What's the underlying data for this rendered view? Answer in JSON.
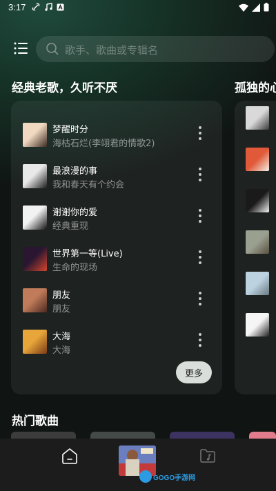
{
  "status_bar": {
    "time": "3:17",
    "icons_left": [
      "link-icon",
      "music-note-icon",
      "font-icon"
    ],
    "icons_right": [
      "wifi-icon",
      "signal-icon",
      "battery-icon"
    ]
  },
  "search": {
    "placeholder": "歌手、歌曲或专辑名"
  },
  "sections": {
    "classic_title": "经典老歌，久听不厌",
    "lonely_title": "孤独的心",
    "hot_title": "热门歌曲"
  },
  "classic_songs": [
    {
      "title": "梦醒时分",
      "subtitle": "海枯石烂(李翊君的情歌2)",
      "thumb_colors": [
        "#f0d9c0",
        "#3b2a22"
      ]
    },
    {
      "title": "最浪漫的事",
      "subtitle": "我和春天有个约会",
      "thumb_colors": [
        "#e8e8e8",
        "#1a1a1a"
      ]
    },
    {
      "title": "谢谢你的爱",
      "subtitle": "经典重现",
      "thumb_colors": [
        "#f2f2f2",
        "#111111"
      ]
    },
    {
      "title": "世界第一等(Live)",
      "subtitle": "生命的现场",
      "thumb_colors": [
        "#2a1630",
        "#d4452e"
      ]
    },
    {
      "title": "朋友",
      "subtitle": "朋友",
      "thumb_colors": [
        "#c07b5a",
        "#4a2a20"
      ]
    },
    {
      "title": "大海",
      "subtitle": "大海",
      "thumb_colors": [
        "#e8a63a",
        "#7a3a16"
      ]
    }
  ],
  "more_label": "更多",
  "lonely_thumbs": [
    [
      "#d9d9d9",
      "#3a3a3a"
    ],
    [
      "#e05a3a",
      "#f3efe6"
    ],
    [
      "#1a1a1a",
      "#f3f3f3"
    ],
    [
      "#9aa090",
      "#5a5040"
    ],
    [
      "#bcd2e0",
      "#6a7a80"
    ],
    [
      "#f5f5f5",
      "#222222"
    ]
  ],
  "hot_cards": [
    "#3c3c3c",
    "#434a48",
    "#3d3360",
    "#e07c8c"
  ],
  "watermark": {
    "text": "GOGO手游网"
  },
  "colors": {
    "accent_bg": "#1f4a3c",
    "card_bg": "rgba(255,255,255,0.06)",
    "more_button_bg": "#d9dedb"
  }
}
